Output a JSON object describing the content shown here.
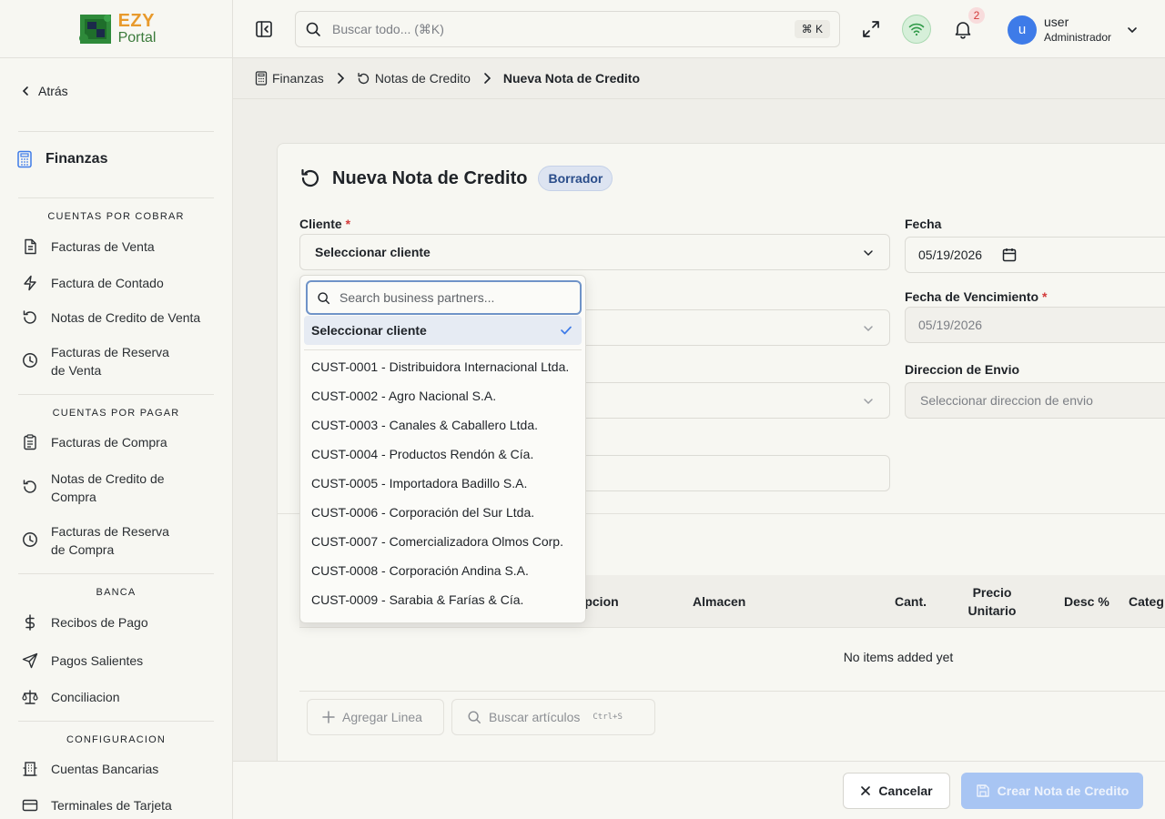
{
  "brand": {
    "name_top": "EZY",
    "name_bottom": "Portal"
  },
  "sidebar": {
    "back_label": "Atrás",
    "section_title": "Finanzas",
    "groups": [
      {
        "title": "CUENTAS POR COBRAR",
        "items": [
          {
            "label": "Facturas de Venta",
            "icon": "document-icon"
          },
          {
            "label": "Factura de Contado",
            "icon": "bolt-icon"
          },
          {
            "label": "Notas de Credito de Venta",
            "icon": "undo-icon"
          },
          {
            "label": "Facturas de Reserva de Venta",
            "icon": "clock-icon"
          }
        ]
      },
      {
        "title": "CUENTAS POR PAGAR",
        "items": [
          {
            "label": "Facturas de Compra",
            "icon": "clipboard-icon"
          },
          {
            "label": "Notas de Credito de Compra",
            "icon": "undo-icon"
          },
          {
            "label": "Facturas de Reserva de Compra",
            "icon": "clock-icon"
          }
        ]
      },
      {
        "title": "BANCA",
        "items": [
          {
            "label": "Recibos de Pago",
            "icon": "dollar-icon"
          },
          {
            "label": "Pagos Salientes",
            "icon": "send-icon"
          },
          {
            "label": "Conciliacion",
            "icon": "scale-icon"
          }
        ]
      },
      {
        "title": "CONFIGURACION",
        "items": [
          {
            "label": "Cuentas Bancarias",
            "icon": "bank-icon"
          },
          {
            "label": "Terminales de Tarjeta",
            "icon": "card-icon"
          }
        ]
      }
    ]
  },
  "topbar": {
    "search_placeholder": "Buscar todo... (⌘K)",
    "shortcut": "⌘ K",
    "notifications_count": "2",
    "user_initial": "u",
    "user_name": "user",
    "user_role": "Administrador"
  },
  "breadcrumb": {
    "items": [
      "Finanzas",
      "Notas de Credito"
    ],
    "current": "Nueva Nota de Credito"
  },
  "form": {
    "title": "Nueva Nota de Credito",
    "status_badge": "Borrador",
    "cliente_label": "Cliente",
    "cliente_value": "Seleccionar cliente",
    "fecha_label": "Fecha",
    "fecha_value": "05/19/2026",
    "vencimiento_label": "Fecha de Vencimiento",
    "vencimiento_value": "05/19/2026",
    "direccion_label": "Direccion de Envio",
    "direccion_placeholder": "Seleccionar direccion de envio",
    "required_mark": "*"
  },
  "table": {
    "headers": [
      "ripcion",
      "Almacen",
      "Cant.",
      "Precio Unitario",
      "Desc %",
      "Categ"
    ],
    "empty_text": "No items added yet",
    "add_line": "Agregar Linea",
    "search_items": "Buscar artículos",
    "search_shortcut": "Ctrl+S"
  },
  "footer": {
    "cancel": "Cancelar",
    "create": "Crear Nota de Credito"
  },
  "dropdown": {
    "search_placeholder": "Search business partners...",
    "selected": "Seleccionar cliente",
    "options": [
      "CUST-0001 - Distribuidora Internacional Ltda.",
      "CUST-0002 - Agro Nacional S.A.",
      "CUST-0003 - Canales & Caballero Ltda.",
      "CUST-0004 - Productos Rendón & Cía.",
      "CUST-0005 - Importadora Badillo S.A.",
      "CUST-0006 - Corporación del Sur Ltda.",
      "CUST-0007 - Comercializadora Olmos Corp.",
      "CUST-0008 - Corporación Andina S.A.",
      "CUST-0009 - Sarabia & Farías & Cía."
    ]
  },
  "colors": {
    "accent": "#3e7be8",
    "badge_bg": "#dde4f1",
    "required": "#d33a3a",
    "create_disabled": "#a8c5f3"
  }
}
